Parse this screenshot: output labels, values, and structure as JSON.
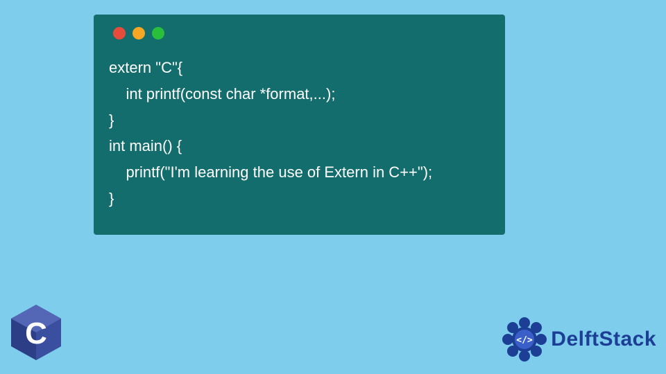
{
  "code": {
    "language": "cpp",
    "lines": [
      "extern \"C\"{",
      "    int printf(const char *format,...);",
      "}",
      "int main() {",
      "    printf(\"I'm learning the use of Extern in C++\");",
      "}"
    ]
  },
  "window": {
    "dot_red": "#e74b3b",
    "dot_yellow": "#f5a623",
    "dot_green": "#2abf3a",
    "bg": "#146d6d"
  },
  "logos": {
    "c_letter": "C",
    "delft_label": "DelftStack",
    "delft_badge_inner": "</>"
  },
  "colors": {
    "page_bg": "#7ecdec",
    "code_text": "#ffffff",
    "delft_blue": "#1c3f95",
    "c_blue_dark": "#2c3e86",
    "c_blue_light": "#5466b6"
  }
}
